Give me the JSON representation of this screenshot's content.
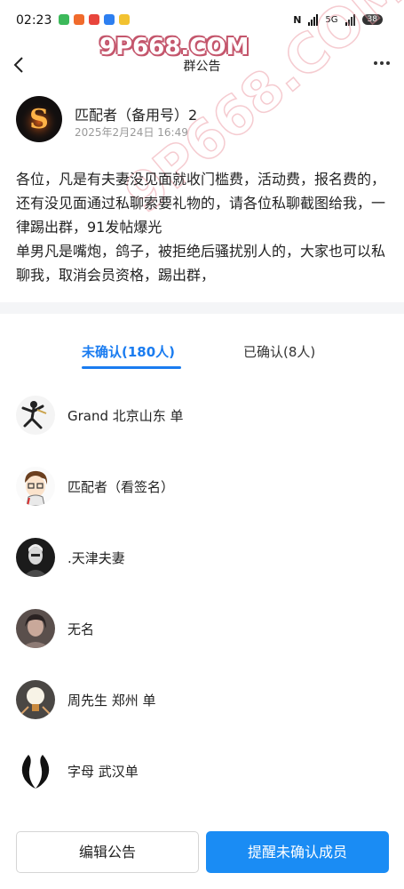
{
  "status_bar": {
    "time": "02:23",
    "battery": "38",
    "network": "5G",
    "app_colors": [
      "#3cb95a",
      "#f06b2c",
      "#e8453c",
      "#2d7ff0",
      "#f2c230"
    ]
  },
  "watermark": {
    "top": "9P668.COM",
    "diagonal": "9P668.COM"
  },
  "nav": {
    "title": "群公告"
  },
  "announcement": {
    "poster_name": "匹配者（备用号）2",
    "avatar_letter": "S",
    "timestamp": "2025年2月24日 16:49",
    "body": "各位，凡是有夫妻没见面就收门槛费，活动费，报名费的，还有没见面通过私聊索要礼物的，请各位私聊截图给我，一律踢出群，91发帖爆光\n单男凡是嘴炮，鸽子，被拒绝后骚扰别人的，大家也可以私聊我，取消会员资格，踢出群，"
  },
  "tabs": {
    "unconfirmed": "未确认(180人)",
    "confirmed": "已确认(8人)",
    "active": "unconfirmed"
  },
  "members": [
    {
      "name": "Grand 北京山东 单",
      "avatar": "dancer-avatar"
    },
    {
      "name": "匹配者（看签名）",
      "avatar": "cartoon-boy-avatar"
    },
    {
      "name": ".天津夫妻",
      "avatar": "dark-photo-avatar"
    },
    {
      "name": "无名",
      "avatar": "portrait-avatar"
    },
    {
      "name": "周先生 郑州 单",
      "avatar": "lightbulb-avatar"
    },
    {
      "name": "字母 武汉单",
      "avatar": "horns-avatar"
    }
  ],
  "buttons": {
    "edit": "编辑公告",
    "remind": "提醒未确认成员"
  },
  "colors": {
    "accent": "#1a8cf4",
    "tab_active": "#1a7cf0"
  }
}
